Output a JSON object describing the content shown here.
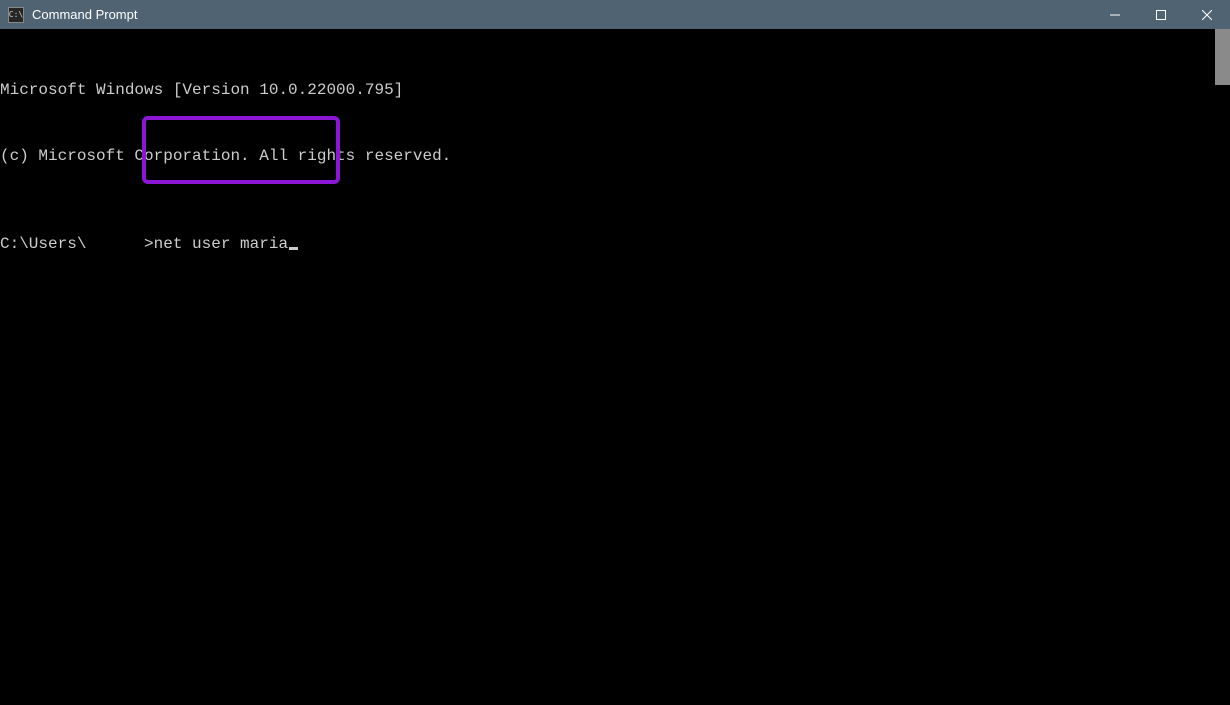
{
  "titlebar": {
    "icon_label": "C:\\",
    "title": "Command Prompt"
  },
  "terminal": {
    "line1": "Microsoft Windows [Version 10.0.22000.795]",
    "line2": "(c) Microsoft Corporation. All rights reserved.",
    "prompt_path": "C:\\Users\\      >",
    "command": "net user maria"
  }
}
